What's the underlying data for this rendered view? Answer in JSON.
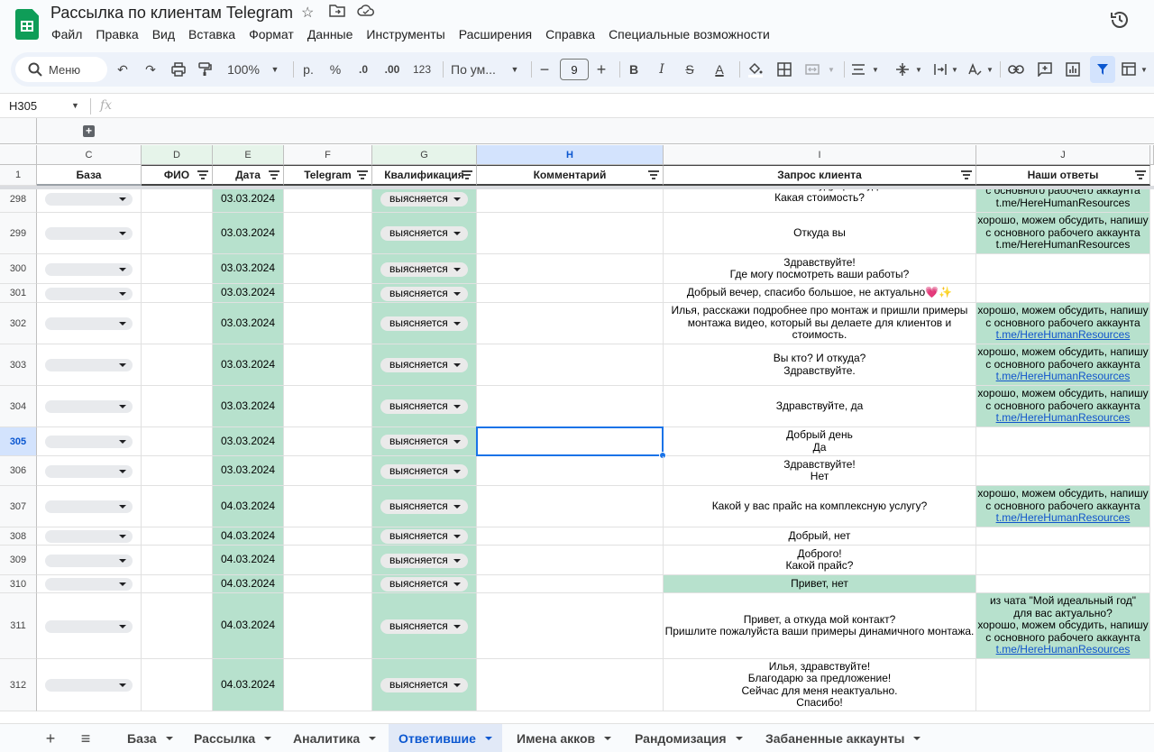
{
  "doc": {
    "title": "Рассылка по клиентам Telegram",
    "brand_color": "#0f9d58"
  },
  "menu": [
    "Файл",
    "Правка",
    "Вид",
    "Вставка",
    "Формат",
    "Данные",
    "Инструменты",
    "Расширения",
    "Справка",
    "Специальные возможности"
  ],
  "toolbar": {
    "search_label": "Меню",
    "zoom": "100%",
    "currency": "р.",
    "percent": "%",
    "dec_decrease": ".0",
    "dec_increase": ".00",
    "number_format": "123",
    "font_name": "По ум...",
    "font_size": "9",
    "bold": "B",
    "italic": "I",
    "strike": "S",
    "text_color": "A"
  },
  "formula_bar": {
    "cell_ref": "H305",
    "fx": "fx"
  },
  "columns": [
    {
      "letter": "C",
      "header": "База"
    },
    {
      "letter": "D",
      "header": "ФИО"
    },
    {
      "letter": "E",
      "header": "Дата"
    },
    {
      "letter": "F",
      "header": "Telegram"
    },
    {
      "letter": "G",
      "header": "Квалификация"
    },
    {
      "letter": "H",
      "header": "Комментарий"
    },
    {
      "letter": "I",
      "header": "Запрос клиента"
    },
    {
      "letter": "J",
      "header": "Наши ответы"
    }
  ],
  "header_row_number": "1",
  "rows": [
    {
      "n": "298",
      "date": "03.03.2024",
      "status": "выясняется",
      "request": "Возможно в будущем будет\nКакая стоимость?",
      "reply": "с основного рабочего аккаунта\nt.me/HereHumanResources",
      "reply_link": false
    },
    {
      "n": "299",
      "date": "03.03.2024",
      "status": "выясняется",
      "request": "Откуда вы",
      "reply": "хорошо, можем обсудить, напишу\nс основного рабочего аккаунта\nt.me/HereHumanResources",
      "reply_link": false
    },
    {
      "n": "300",
      "date": "03.03.2024",
      "status": "выясняется",
      "request": "Здравствуйте!\nГде могу посмотреть ваши работы?",
      "reply": ""
    },
    {
      "n": "301",
      "date": "03.03.2024",
      "status": "выясняется",
      "request": "Добрый вечер, спасибо большое, не актуально💗✨",
      "reply": ""
    },
    {
      "n": "302",
      "date": "03.03.2024",
      "status": "выясняется",
      "request": "Илья, расскажи подробнее про монтаж и пришли примеры\nмонтажа видео, который вы делаете для клиентов и\nстоимость.",
      "reply_text": "хорошо, можем обсудить, напишу\nс основного рабочего аккаунта",
      "reply_url": "t.me/HereHumanResources"
    },
    {
      "n": "303",
      "date": "03.03.2024",
      "status": "выясняется",
      "request": "Вы кто? И откуда?\nЗдравствуйте.",
      "reply_text": "хорошо, можем обсудить, напишу\nс основного рабочего аккаунта",
      "reply_url": "t.me/HereHumanResources"
    },
    {
      "n": "304",
      "date": "03.03.2024",
      "status": "выясняется",
      "request": "Здравствуйте, да",
      "reply_text": "хорошо, можем обсудить, напишу\nс основного рабочего аккаунта",
      "reply_url": "t.me/HereHumanResources"
    },
    {
      "n": "305",
      "date": "03.03.2024",
      "status": "выясняется",
      "request": "Добрый день\nДа",
      "reply": ""
    },
    {
      "n": "306",
      "date": "03.03.2024",
      "status": "выясняется",
      "request": "Здравствуйте!\nНет",
      "reply": ""
    },
    {
      "n": "307",
      "date": "04.03.2024",
      "status": "выясняется",
      "request": "Какой у вас прайс на комплексную услугу?",
      "reply_text": "хорошо, можем обсудить, напишу\nс основного рабочего аккаунта",
      "reply_url": "t.me/HereHumanResources"
    },
    {
      "n": "308",
      "date": "04.03.2024",
      "status": "выясняется",
      "request": "Добрый, нет",
      "reply": ""
    },
    {
      "n": "309",
      "date": "04.03.2024",
      "status": "выясняется",
      "request": "Доброго!\nКакой прайс?",
      "reply": ""
    },
    {
      "n": "310",
      "date": "04.03.2024",
      "status": "выясняется",
      "request": "Привет, нет",
      "reply": ""
    },
    {
      "n": "311",
      "date": "04.03.2024",
      "status": "выясняется",
      "request": "Привет, а откуда мой контакт?\nПришлите пожалуйста ваши примеры динамичного монтажа.",
      "reply_text": "из чата \"Мой идеальный год\"\nдля вас актуально?\nхорошо, можем обсудить, напишу\nс основного рабочего аккаунта",
      "reply_url": "t.me/HereHumanResources"
    },
    {
      "n": "312",
      "date": "04.03.2024",
      "status": "выясняется",
      "request": "Илья, здравствуйте!\nБлагодарю за предложение!\nСейчас для меня неактуально.\nСпасибо!",
      "reply": ""
    }
  ],
  "sheet_tabs": [
    "База",
    "Рассылка",
    "Аналитика",
    "Ответившие",
    "Имена акков",
    "Рандомизация",
    "Забаненные аккаунты"
  ],
  "active_tab": "Ответившие",
  "colors": {
    "green_fill": "#b7e1cd",
    "selection": "#1a73e8",
    "link": "#1155cc"
  }
}
